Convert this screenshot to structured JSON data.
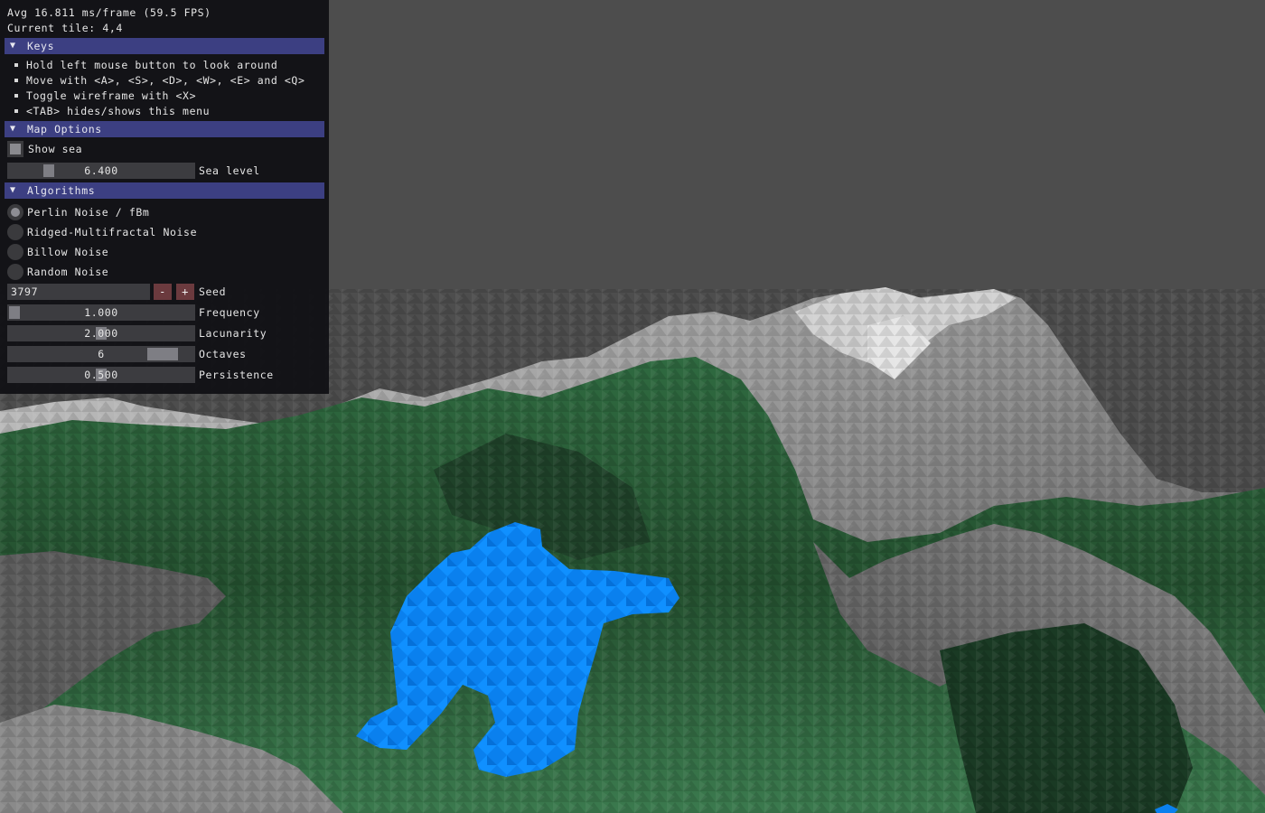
{
  "stats": {
    "frame_time": "Avg 16.811 ms/frame (59.5 FPS)",
    "current_tile": "Current tile: 4,4"
  },
  "keys": {
    "header": "Keys",
    "items": [
      "Hold left mouse button to look around",
      "Move with <A>, <S>, <D>, <W>, <E> and <Q>",
      "Toggle wireframe with <X>",
      "<TAB> hides/shows this menu"
    ]
  },
  "map_options": {
    "header": "Map Options",
    "show_sea_label": "Show sea",
    "show_sea_checked": true,
    "sea_level_value": "6.400",
    "sea_level_label": "Sea level",
    "sea_level_fraction": 0.2
  },
  "algorithms": {
    "header": "Algorithms",
    "options": [
      "Perlin Noise / fBm",
      "Ridged-Multifractal Noise",
      "Billow Noise",
      "Random Noise"
    ],
    "selected_index": 0,
    "seed_value": "3797",
    "seed_minus": "-",
    "seed_plus": "+",
    "seed_label": "Seed",
    "frequency_value": "1.000",
    "frequency_label": "Frequency",
    "frequency_fraction": 0.0,
    "lacunarity_value": "2.000",
    "lacunarity_label": "Lacunarity",
    "lacunarity_fraction": 0.5,
    "octaves_value": "6",
    "octaves_label": "Octaves",
    "octaves_fraction": 0.9,
    "persistence_value": "0.500",
    "persistence_label": "Persistence",
    "persistence_fraction": 0.5
  },
  "colors": {
    "sky": "#4d4d4d",
    "grass": "#3d7a4c",
    "grass_dark": "#173321",
    "rock": "#7a7a7a",
    "snow": "#d8d8d8",
    "water": "#0a82f0",
    "panel_header": "#3c3f82"
  }
}
